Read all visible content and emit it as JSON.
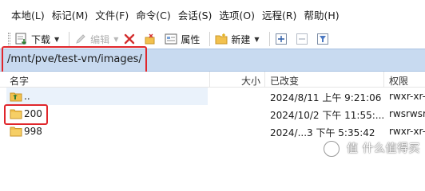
{
  "menu": {
    "items": [
      "本地(L)",
      "标记(M)",
      "文件(F)",
      "命令(C)",
      "会话(S)",
      "选项(O)",
      "远程(R)",
      "帮助(H)"
    ]
  },
  "toolbar": {
    "download_label": "下载",
    "edit_label": "编辑",
    "properties_label": "属性",
    "new_label": "新建"
  },
  "address": {
    "path": "/mnt/pve/test-vm/images/"
  },
  "file_list": {
    "columns": [
      "名字",
      "大小",
      "已改变",
      "权限"
    ],
    "rows": [
      {
        "name": "..",
        "size": "",
        "modified": "2024/8/11 上午 9:21:06",
        "permissions": "rwxr-xr-"
      },
      {
        "name": "200",
        "size": "",
        "modified": "2024/10/2 下午 11:55:...",
        "permissions": "rwsrwsr"
      },
      {
        "name": "998",
        "size": "",
        "modified": "2024/...3 下午 5:35:42",
        "permissions": "rwxr-xr-"
      }
    ]
  },
  "watermark": {
    "text": "值 什么值得买"
  },
  "colors": {
    "address_bar": "#c8daf0",
    "highlight_box": "#e0262b",
    "folder": "#f2c14e"
  }
}
